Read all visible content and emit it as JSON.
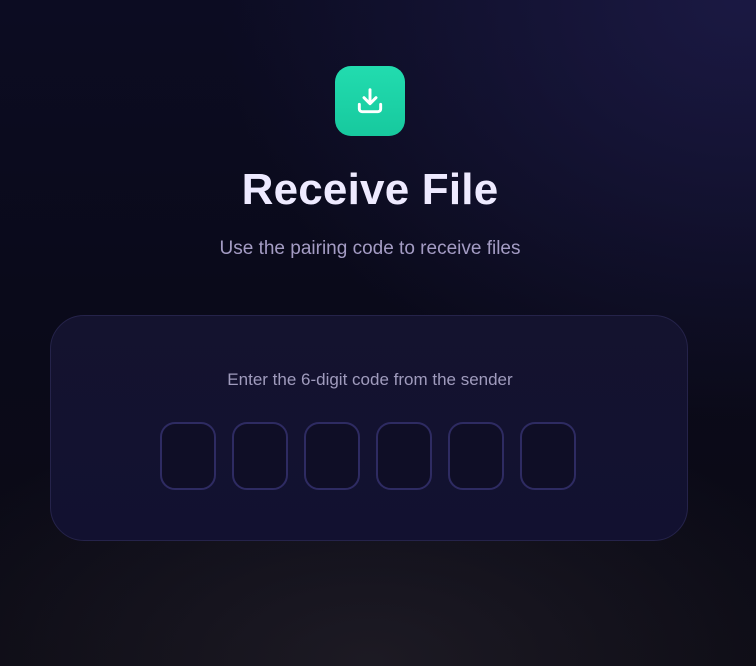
{
  "header": {
    "icon": "download-icon",
    "icon_color": "#1ed6aa",
    "title": "Receive File",
    "subtitle": "Use the pairing code to receive files"
  },
  "code_card": {
    "instruction": "Enter the 6-digit code from the sender",
    "digits": [
      {
        "value": ""
      },
      {
        "value": ""
      },
      {
        "value": ""
      },
      {
        "value": ""
      },
      {
        "value": ""
      },
      {
        "value": ""
      }
    ]
  },
  "colors": {
    "accent": "#1ed6aa",
    "background": "#0a0a1a",
    "card": "#13122f",
    "input_border": "#2e2b62",
    "title": "#eeeaff",
    "muted_text": "#a49cc4"
  }
}
